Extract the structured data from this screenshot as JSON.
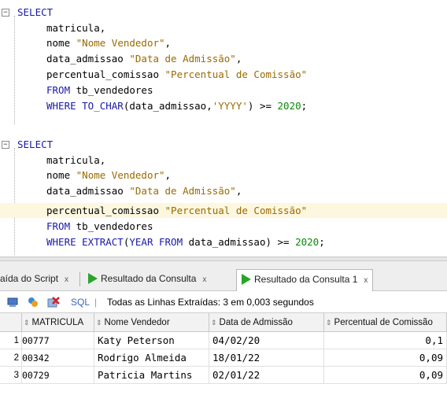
{
  "editor": {
    "query1": {
      "l1": "SELECT",
      "l2": "matricula,",
      "l3_col": "nome",
      "l3_alias": "\"Nome Vendedor\"",
      "l3_end": ",",
      "l4_col": "data_admissao",
      "l4_alias": "\"Data de Admissão\"",
      "l4_end": ",",
      "l5_col": "percentual_comissao",
      "l5_alias": "\"Percentual de Comissão\"",
      "l6_kw": "FROM",
      "l6_tbl": "tb_vendedores",
      "l7_kw": "WHERE TO_CHAR",
      "l7_a": "(data_admissao,",
      "l7_str": "'YYYY'",
      "l7_b": ") >=",
      "l7_num": "2020",
      "l7_end": ";"
    },
    "query2": {
      "l1": "SELECT",
      "l2": "matricula,",
      "l3_col": "nome",
      "l3_alias": "\"Nome Vendedor\"",
      "l3_end": ",",
      "l4_col": "data_admissao",
      "l4_alias": "\"Data de Admissão\"",
      "l4_end": ",",
      "l5_col": "percentual_comissao",
      "l5_alias": "\"Percentual de Comissão\"",
      "l6_kw": "FROM",
      "l6_tbl": "tb_vendedores",
      "l7_kw": "WHERE EXTRACT",
      "l7_a": "(",
      "l7_kw2": "YEAR FROM",
      "l7_b": "data_admissao) >=",
      "l7_num": "2020",
      "l7_end": ";"
    }
  },
  "tabs": [
    {
      "label": "aída do Script",
      "close": "x"
    },
    {
      "label": "Resultado da Consulta",
      "close": "x"
    },
    {
      "label": "Resultado da Consulta 1",
      "close": "x"
    }
  ],
  "toolbar": {
    "sql_label": "SQL",
    "divider": "|",
    "status": "Todas as Linhas Extraídas: 3 em 0,003 segundos",
    "icons": [
      "pin-icon",
      "refresh-icon",
      "cancel-icon"
    ]
  },
  "grid": {
    "columns": [
      "MATRICULA",
      "Nome Vendedor",
      "Data de Admissão",
      "Percentual de Comissão"
    ],
    "rows": [
      {
        "n": "1",
        "matricula": "00777",
        "nome": "Katy Peterson",
        "data": "04/02/20",
        "pct": "0,1"
      },
      {
        "n": "2",
        "matricula": "00342",
        "nome": "Rodrigo Almeida",
        "data": "18/01/22",
        "pct": "0,09"
      },
      {
        "n": "3",
        "matricula": "00729",
        "nome": "Patricia Martins",
        "data": "02/01/22",
        "pct": "0,09"
      }
    ]
  },
  "colors": {
    "keyword": "#1a1aa6",
    "string": "#9a6a00",
    "number": "#0a8a0a",
    "run_icon": "#2aa52a",
    "current_line": "#fdf7e0"
  }
}
